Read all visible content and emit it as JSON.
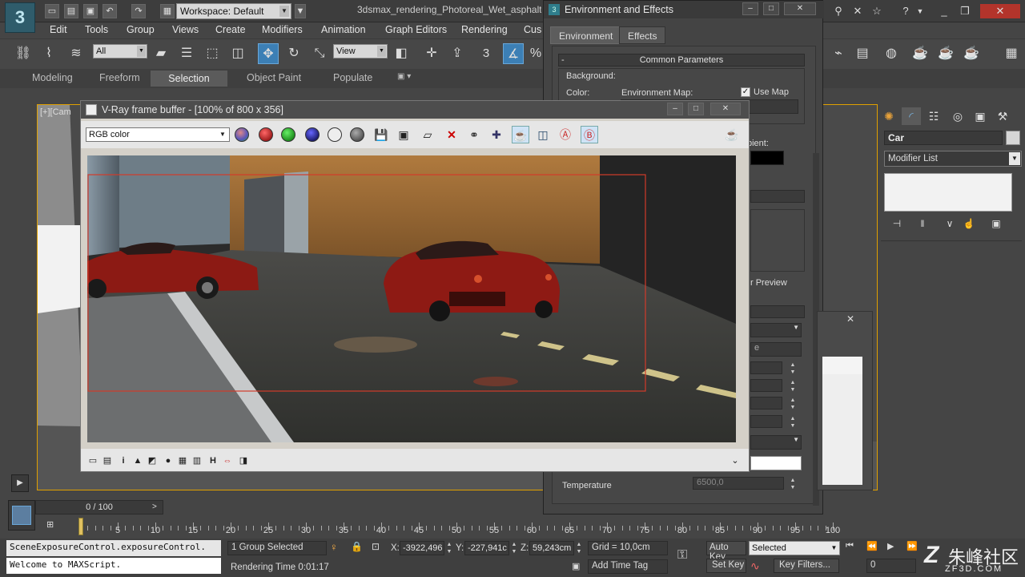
{
  "titlebar": {
    "workspace_label": "Workspace: Default",
    "document_title": "3dsmax_rendering_Photoreal_Wet_asphalt_"
  },
  "menu": [
    "Edit",
    "Tools",
    "Group",
    "Views",
    "Create",
    "Modifiers",
    "Animation",
    "Graph Editors",
    "Rendering",
    "Cus"
  ],
  "toolbar": {
    "selection_filter": "All",
    "reference_coord": "View",
    "snap_label": "3",
    "percent_label": "%"
  },
  "ribbon": {
    "tabs": [
      "Modeling",
      "Freeform",
      "Selection",
      "Object Paint",
      "Populate"
    ]
  },
  "viewport": {
    "label": "[+][Cam"
  },
  "environment_dialog": {
    "title": "Environment and Effects",
    "tabs": [
      "Environment",
      "Effects"
    ],
    "common_parameters": "Common Parameters",
    "background_label": "Background:",
    "color_label": "Color:",
    "env_map_label": "Environment Map:",
    "use_map_label": "Use Map",
    "ambient_label": "bient:",
    "preview_label": "r Preview",
    "temperature_label": "Temperature",
    "temperature_value": "6500,0",
    "partial_label": "e"
  },
  "vfb": {
    "title": "V-Ray frame buffer - [100% of 800 x 356]",
    "channel": "RGB color"
  },
  "command_panel": {
    "object_name": "Car",
    "modifier_list": "Modifier List"
  },
  "timeline": {
    "slider_label": "0 / 100",
    "ticks": [
      0,
      5,
      10,
      15,
      20,
      25,
      30,
      35,
      40,
      45,
      50,
      55,
      60,
      65,
      70,
      75,
      80,
      85,
      90,
      95,
      100
    ]
  },
  "statusbar": {
    "maxscript_line1": "SceneExposureControl.exposureControl.",
    "maxscript_line2": "Welcome to MAXScript.",
    "selection_status": "1 Group Selected",
    "rendering_time": "Rendering Time  0:01:17",
    "x_label": "X:",
    "x_value": "-3922,496",
    "y_label": "Y:",
    "y_value": "-227,941c",
    "z_label": "Z:",
    "z_value": "59,243cm",
    "grid": "Grid = 10,0cm",
    "add_time_tag": "Add Time Tag",
    "auto_key": "Auto Key",
    "set_key": "Set Key",
    "selected_drop": "Selected",
    "key_filters": "Key Filters...",
    "frame_value": "0"
  },
  "watermark": {
    "text": "朱峰社区",
    "url_text": "ZF3D.COM"
  }
}
